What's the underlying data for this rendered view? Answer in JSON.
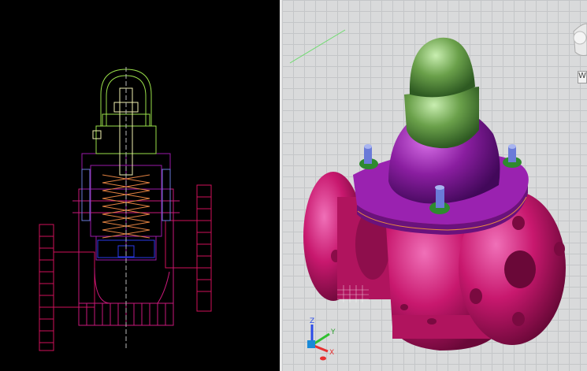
{
  "left_viewport": {
    "background": "#000000",
    "drawing_style": "wireframe"
  },
  "right_viewport": {
    "background": "#d9dadb",
    "drawing_style": "shaded"
  },
  "navcube": {
    "label": "W"
  },
  "ucs_icon": {
    "x_label": "X",
    "y_label": "Y",
    "z_label": "Z"
  },
  "colors": {
    "body_magenta": "#c8186e",
    "bonnet_purple": "#8a1ea0",
    "cap_green": "#6aa04a",
    "bolt_blue": "#6a7ad8"
  }
}
